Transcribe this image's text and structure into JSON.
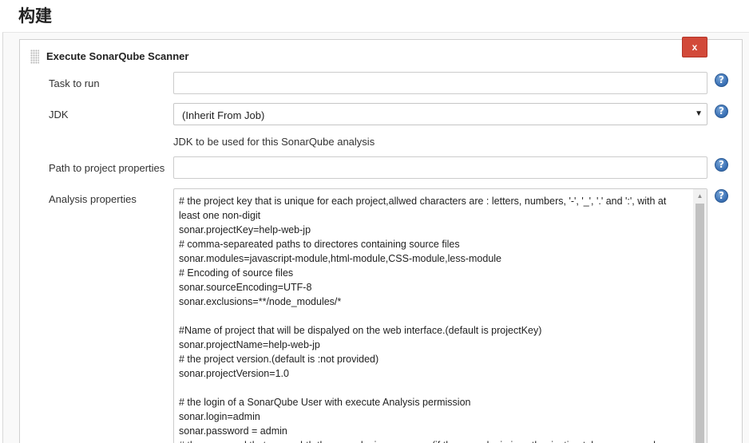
{
  "section": {
    "title": "构建"
  },
  "step": {
    "title": "Execute SonarQube Scanner",
    "delete_label": "x"
  },
  "fields": {
    "task_to_run": {
      "label": "Task to run",
      "value": ""
    },
    "jdk": {
      "label": "JDK",
      "selected": "(Inherit From Job)",
      "help_text": "JDK to be used for this SonarQube analysis"
    },
    "project_properties_path": {
      "label": "Path to project properties",
      "value": ""
    },
    "analysis_properties": {
      "label": "Analysis properties",
      "lines": [
        "# the project key that is unique for each project,allwed characters are : letters, numbers, '-', '_', '.' and ':', with at",
        "least one non-digit",
        "sonar.projectKey=help-web-jp",
        "# comma-separeated paths to directores containing source files",
        "sonar.modules=javascript-module,html-module,CSS-module,less-module",
        "# Encoding of source files",
        "sonar.sourceEncoding=UTF-8",
        "sonar.exclusions=**/node_modules/*",
        "",
        "#Name of project that will be dispalyed on the web interface.(default is projectKey)",
        "sonar.projectName=help-web-jp",
        "# the project version.(default is :not provided)",
        "sonar.projectVersion=1.0",
        "",
        "# the login of a SonarQube User with execute Analysis permission",
        "sonar.login=admin",
        "sonar.password = admin",
        "# the password that goes whth the sonar.login username (if the sonar.login is authenication token, password"
      ]
    }
  },
  "help_icon_glyph": "?"
}
